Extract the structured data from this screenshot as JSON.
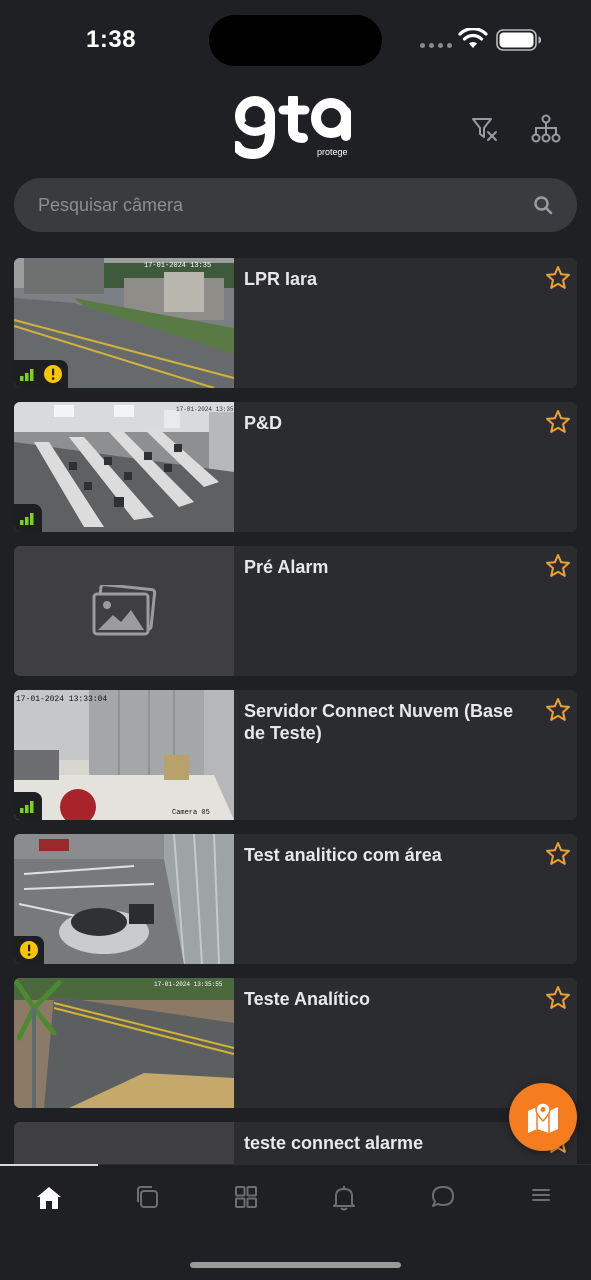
{
  "status_bar": {
    "time": "1:38"
  },
  "header": {
    "logo_text": "gta",
    "logo_subtext": "protege"
  },
  "search": {
    "placeholder": "Pesquisar câmera",
    "value": ""
  },
  "cameras": [
    {
      "name": "LPR Iara",
      "thumbnail": "street-scene",
      "signal": true,
      "warning": true
    },
    {
      "name": "P&D",
      "thumbnail": "office-room",
      "signal": true,
      "warning": false
    },
    {
      "name": "Pré Alarm",
      "thumbnail": "no-image-placeholder",
      "signal": false,
      "warning": false
    },
    {
      "name": "Servidor Connect Nuvem (Base de Teste)",
      "thumbnail": "storage-room",
      "signal": true,
      "warning": false
    },
    {
      "name": "Test analitico com área",
      "thumbnail": "parking-lot",
      "signal": false,
      "warning": true
    },
    {
      "name": "Teste Analítico",
      "thumbnail": "road-palm",
      "signal": false,
      "warning": false
    },
    {
      "name": "teste connect alarme",
      "thumbnail": "no-image-placeholder",
      "signal": false,
      "warning": false
    }
  ],
  "tab_bar": {
    "tabs": [
      "home-icon",
      "layers-icon",
      "grid-icon",
      "bell-icon",
      "chat-icon",
      "menu-icon"
    ],
    "active": "home-icon"
  },
  "colors": {
    "accent": "#f57c1f",
    "star": "#f0a030",
    "signal": "#7ed321",
    "warning": "#f7c600",
    "background": "#1f2023",
    "card": "#2b2c30"
  }
}
